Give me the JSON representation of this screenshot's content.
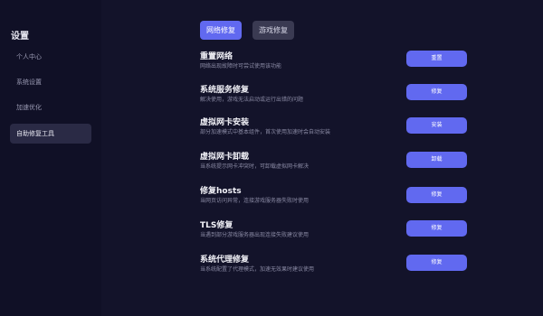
{
  "sidebar": {
    "title": "设置",
    "items": [
      {
        "label": "个人中心"
      },
      {
        "label": "系统设置"
      },
      {
        "label": "加速优化"
      },
      {
        "label": "自助修复工具"
      }
    ]
  },
  "tabs": [
    {
      "label": "网络修复"
    },
    {
      "label": "游戏修复"
    }
  ],
  "repairs": [
    {
      "title": "重置网络",
      "desc": "网络出现故障时可尝试使用该功能",
      "button": "重置"
    },
    {
      "title": "系统服务修复",
      "desc": "解决使用，游戏无法启动或运行出错的问题",
      "button": "修复"
    },
    {
      "title": "虚拟网卡安装",
      "desc": "部分加速模式中基本组件，首次使用加速时会自动安装",
      "button": "安装"
    },
    {
      "title": "虚拟网卡卸载",
      "desc": "当系统提示网卡冲突时，可卸载虚拟网卡解决",
      "button": "卸载"
    },
    {
      "title": "修复hosts",
      "desc": "当网页访问异常，连接游戏服务器失败时使用",
      "button": "修复"
    },
    {
      "title": "TLS修复",
      "desc": "当遇到部分游戏服务器出现连接失败建议使用",
      "button": "修复"
    },
    {
      "title": "系统代理修复",
      "desc": "当系统配置了代理模式，加速无效果时建议使用",
      "button": "修复"
    }
  ],
  "colors": {
    "background": "#13132a",
    "accent": "#6169f0",
    "sidebar_active": "#2a2a45"
  }
}
